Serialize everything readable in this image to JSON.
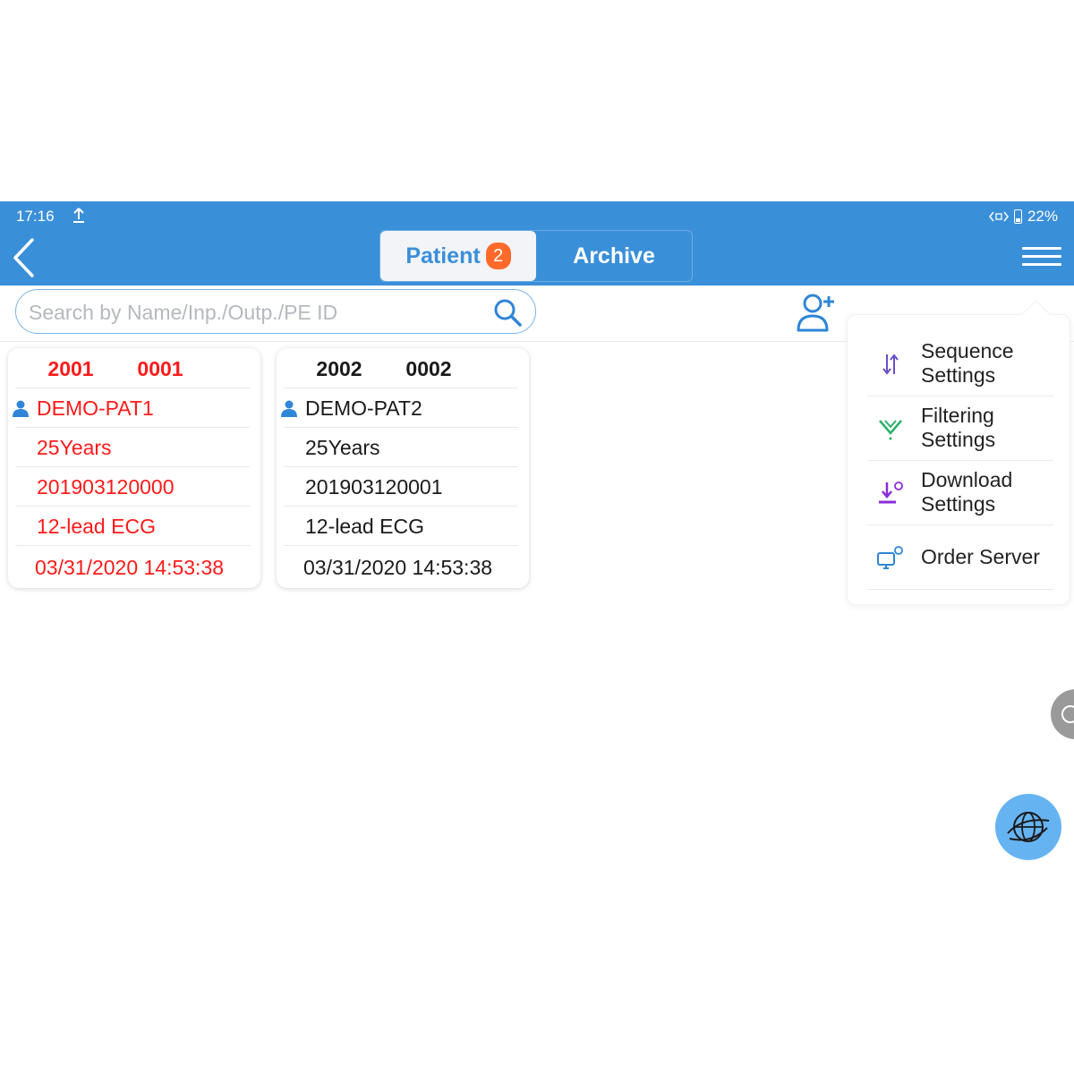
{
  "status_bar": {
    "time": "17:16",
    "battery": "22%"
  },
  "tabs": [
    {
      "label": "Patient",
      "badge": "2",
      "active": true
    },
    {
      "label": "Archive",
      "active": false
    }
  ],
  "search": {
    "placeholder": "Search by Name/Inp./Outp./PE ID",
    "value": ""
  },
  "patients": [
    {
      "id1": "2001",
      "id2": "0001",
      "name": "DEMO-PAT1",
      "age": "25Years",
      "number": "201903120000",
      "exam": "12-lead ECG",
      "datetime": "03/31/2020 14:53:38",
      "color": "#ff1a1a"
    },
    {
      "id1": "2002",
      "id2": "0002",
      "name": "DEMO-PAT2",
      "age": "25Years",
      "number": "201903120001",
      "exam": "12-lead ECG",
      "datetime": "03/31/2020 14:53:38",
      "color": "#1a1a1a"
    }
  ],
  "menu": [
    {
      "label": "Sequence Settings",
      "icon": "sort-icon"
    },
    {
      "label": "Filtering Settings",
      "icon": "filter-icon"
    },
    {
      "label": "Download Settings",
      "icon": "download-settings-icon"
    },
    {
      "label": "Order Server",
      "icon": "monitor-settings-icon"
    }
  ],
  "colors": {
    "header": "#3a8fd9",
    "badge": "#ff6a2b",
    "alert_text": "#ff1a1a"
  }
}
